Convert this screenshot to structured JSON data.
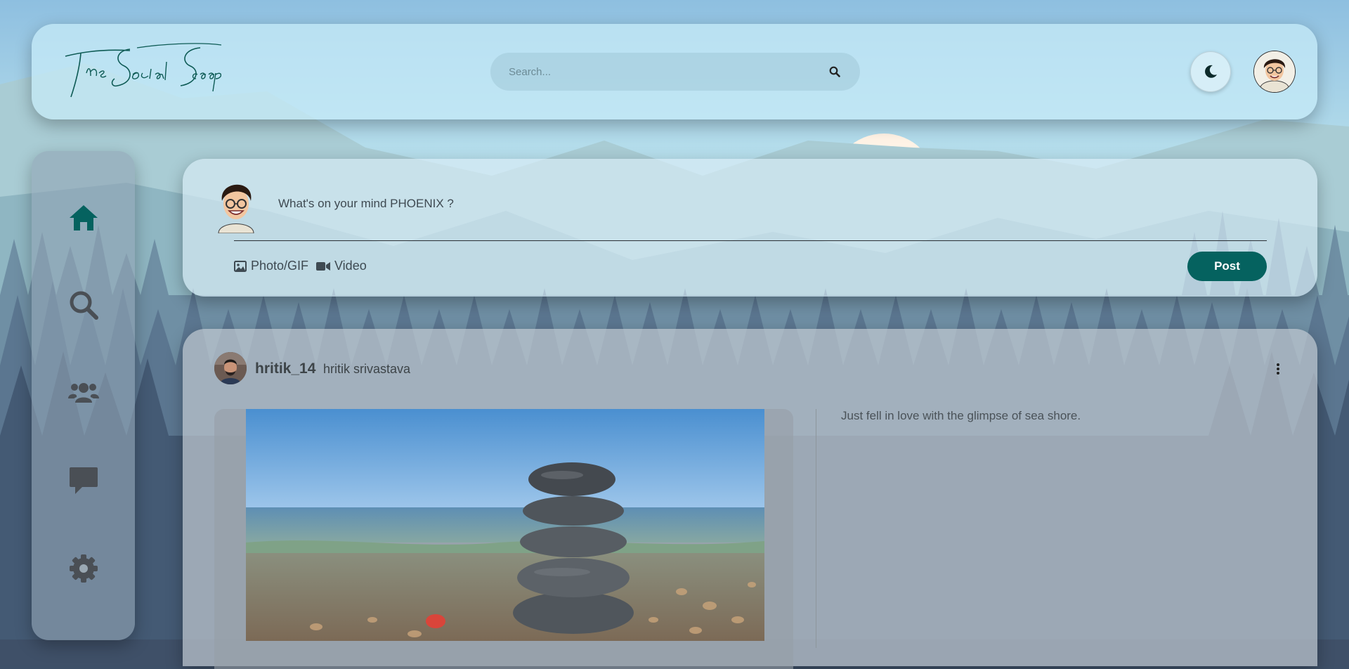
{
  "header": {
    "logo_text": "The Social Scoop",
    "search": {
      "placeholder": "Search..."
    },
    "icons": {
      "search": "search-icon",
      "theme": "moon-icon",
      "avatar": "avatar"
    }
  },
  "sidebar": {
    "items": [
      {
        "icon": "home-icon",
        "active": true
      },
      {
        "icon": "search-icon",
        "active": false
      },
      {
        "icon": "users-icon",
        "active": false
      },
      {
        "icon": "chat-icon",
        "active": false
      },
      {
        "icon": "gear-icon",
        "active": false
      }
    ]
  },
  "composer": {
    "prompt": "What's on your mind PHOENIX ?",
    "photo_label": "Photo/GIF",
    "video_label": "Video",
    "post_label": "Post"
  },
  "post": {
    "username": "hritik_14",
    "full_name": "hritik srivastava",
    "caption": "Just fell in love with the glimpse of sea shore.",
    "image_alt": "stacked stones on pebble beach by the sea"
  },
  "colors": {
    "accent": "#05625f",
    "sky_top": "#8fc0e0",
    "forest": "#3b4f66"
  }
}
